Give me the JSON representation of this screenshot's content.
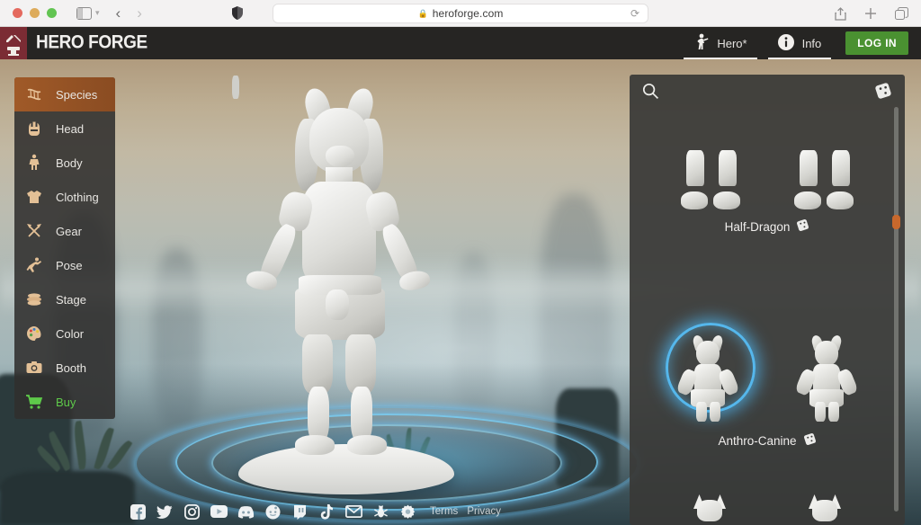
{
  "browser": {
    "url": "heroforge.com",
    "lock_icon": "lock-icon",
    "reload_icon": "reload-icon",
    "sidebar_icon": "sidebar-toggle-icon",
    "back_icon": "back-arrow-icon",
    "forward_icon": "forward-arrow-icon",
    "shield_icon": "privacy-shield-icon",
    "share_icon": "share-icon",
    "newtab_icon": "plus-icon",
    "tabs_icon": "tab-overview-icon"
  },
  "header": {
    "brand": "HERO FORGE",
    "logo_icon": "anvil-shield-logo",
    "logo_color": "#7b2c34",
    "nav": [
      {
        "label": "Hero*",
        "icon": "hero-figure-icon",
        "active": true
      },
      {
        "label": "Info",
        "icon": "info-circle-icon",
        "active": true
      }
    ],
    "login_label": "LOG IN",
    "login_color": "#4a9131"
  },
  "sidebar": {
    "active_color": "#a05a28",
    "items": [
      {
        "label": "Species",
        "icon": "dna-helix-icon",
        "active": true
      },
      {
        "label": "Head",
        "icon": "head-icon",
        "active": false
      },
      {
        "label": "Body",
        "icon": "body-icon",
        "active": false
      },
      {
        "label": "Clothing",
        "icon": "shirt-icon",
        "active": false
      },
      {
        "label": "Gear",
        "icon": "crossed-axes-icon",
        "active": false
      },
      {
        "label": "Pose",
        "icon": "pose-figure-icon",
        "active": false
      },
      {
        "label": "Stage",
        "icon": "stage-base-icon",
        "active": false
      },
      {
        "label": "Color",
        "icon": "palette-icon",
        "active": false
      },
      {
        "label": "Booth",
        "icon": "camera-icon",
        "active": false
      },
      {
        "label": "Buy",
        "icon": "shopping-cart-icon",
        "active": false,
        "color": "#5ec94a"
      }
    ]
  },
  "options_panel": {
    "search_icon": "search-icon",
    "randomize_icon": "dice-icon",
    "scrollbar_accent": "#c8682c",
    "groups": [
      {
        "label": "Half-Dragon",
        "randomize_icon": "dice-icon",
        "kind": "feet",
        "thumbs": [
          {
            "name": "half-dragon-feet-a",
            "selected": false
          },
          {
            "name": "half-dragon-feet-b",
            "selected": false
          }
        ]
      },
      {
        "label": "Anthro-Canine",
        "randomize_icon": "dice-icon",
        "kind": "figure",
        "thumbs": [
          {
            "name": "anthro-canine-female",
            "selected": true
          },
          {
            "name": "anthro-canine-male",
            "selected": false
          }
        ]
      },
      {
        "label": "",
        "kind": "wolf-heads",
        "thumbs": [
          {
            "name": "anthro-feline-a",
            "selected": false
          },
          {
            "name": "anthro-feline-b",
            "selected": false
          }
        ]
      }
    ]
  },
  "viewport": {
    "character": "anthro-canine-miniature",
    "base": "round-stage-base",
    "selection_glow_color": "#56bef5"
  },
  "footer": {
    "social": [
      {
        "name": "facebook-icon",
        "glyph": "f"
      },
      {
        "name": "twitter-icon",
        "glyph": "t"
      },
      {
        "name": "instagram-icon",
        "glyph": "i"
      },
      {
        "name": "youtube-icon",
        "glyph": "y"
      },
      {
        "name": "discord-icon",
        "glyph": "d"
      },
      {
        "name": "reddit-icon",
        "glyph": "r"
      },
      {
        "name": "twitch-icon",
        "glyph": "w"
      },
      {
        "name": "tiktok-icon",
        "glyph": "k"
      },
      {
        "name": "mail-icon",
        "glyph": "m"
      },
      {
        "name": "bug-icon",
        "glyph": "b"
      },
      {
        "name": "gear-icon",
        "glyph": "g"
      }
    ],
    "links": [
      {
        "label": "Terms"
      },
      {
        "label": "Privacy"
      }
    ]
  }
}
